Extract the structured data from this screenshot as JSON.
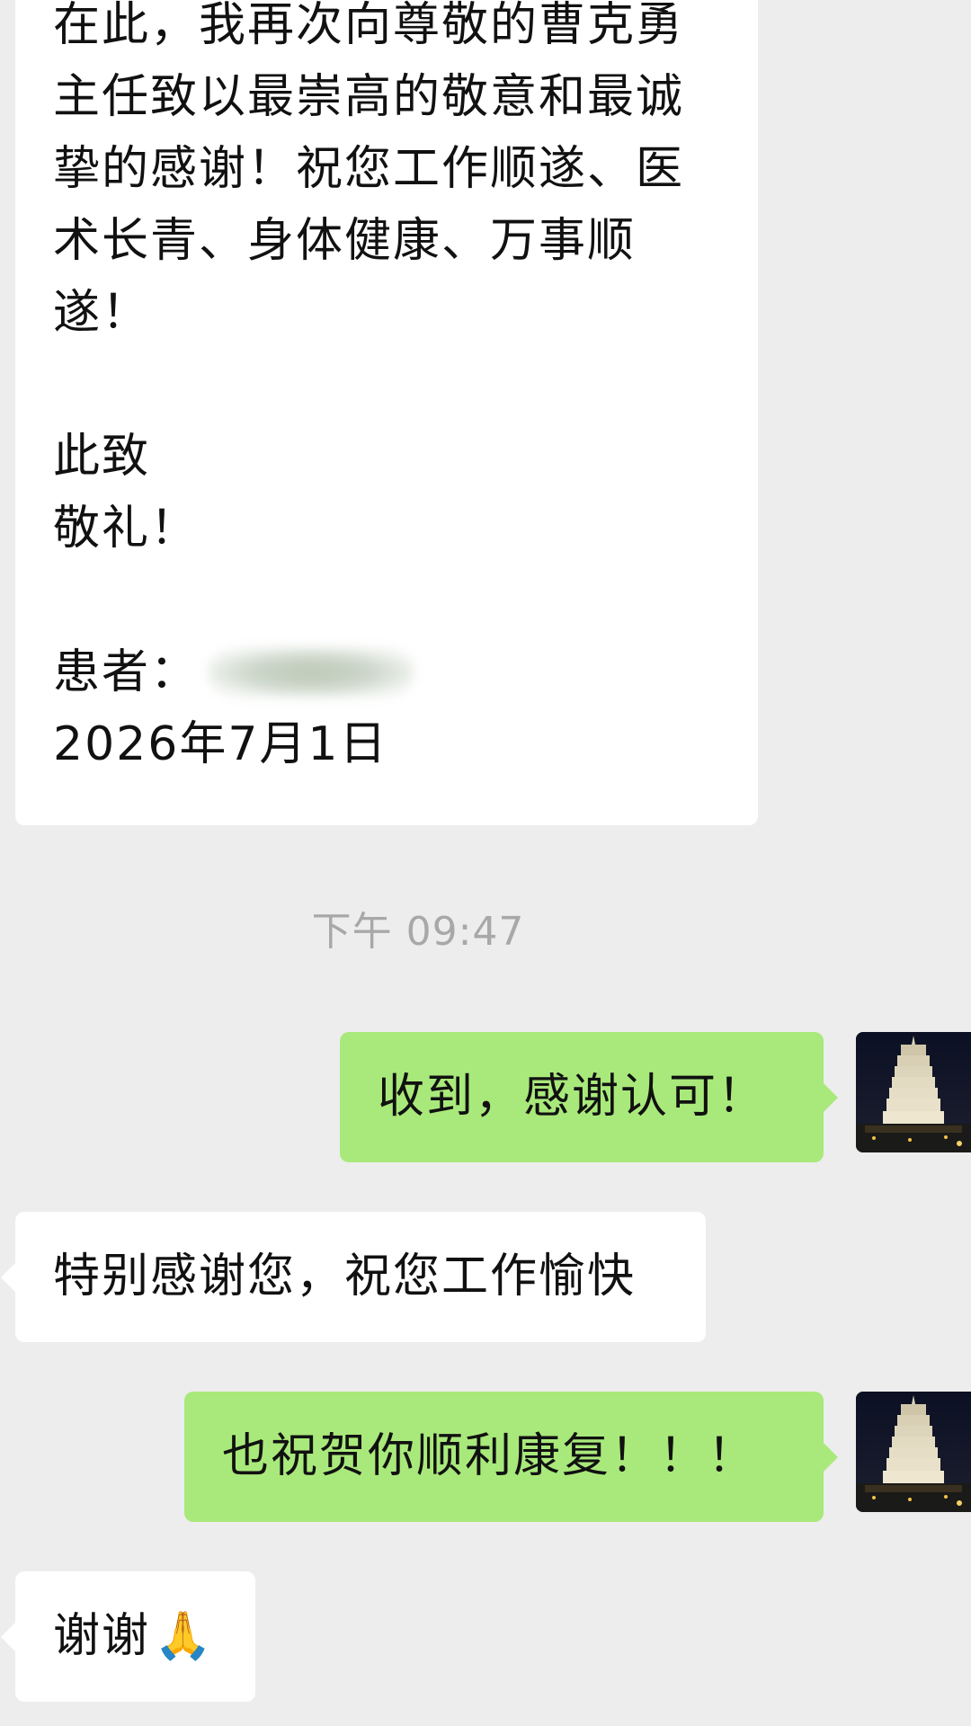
{
  "letter_message": {
    "lines": [
      "在此，我再次向尊敬的曹克勇",
      "主任致以最崇高的敬意和最诚",
      "挚的感谢！祝您工作顺遂、医",
      "术长青、身体健康、万事顺",
      "遂！"
    ],
    "closing_1": "此致",
    "closing_2": "敬礼！",
    "signature_label": "患者：",
    "date": "2026年7月1日"
  },
  "timestamp": "下午 09:47",
  "messages": [
    {
      "side": "right",
      "text": "收到，感谢认可！"
    },
    {
      "side": "left",
      "text": "特别感谢您，祝您工作愉快"
    },
    {
      "side": "right",
      "text": "也祝贺你顺利康复！！！"
    },
    {
      "side": "left",
      "text": "谢谢",
      "emoji": "🙏"
    }
  ],
  "avatar": {
    "description_icon": "pagoda-night-avatar-icon"
  },
  "colors": {
    "background": "#ededed",
    "incoming_bubble": "#ffffff",
    "outgoing_bubble": "#a9e97b",
    "timestamp_text": "#a8a8a8"
  }
}
